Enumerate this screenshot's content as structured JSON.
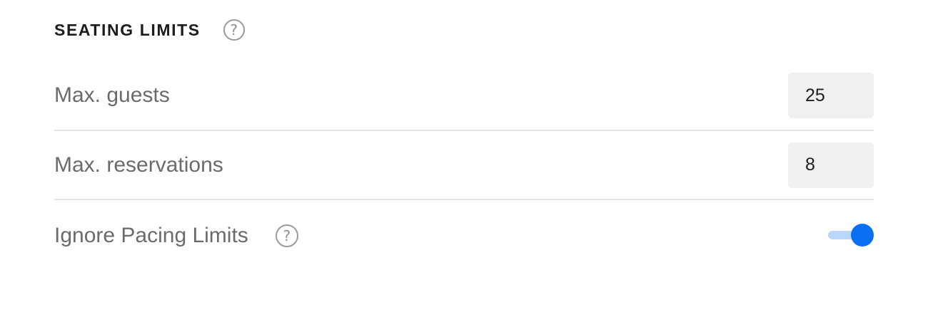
{
  "section": {
    "title": "SEATING LIMITS",
    "help_icon": "question-circle-icon"
  },
  "rows": [
    {
      "label": "Max. guests",
      "value": "25"
    },
    {
      "label": "Max. reservations",
      "value": "8"
    }
  ],
  "pacing": {
    "label": "Ignore Pacing Limits",
    "help_icon": "question-circle-icon",
    "toggle_on": true
  },
  "colors": {
    "accent": "#0a6ff3",
    "toggle_track": "#b9d8f9",
    "label_text": "#6b6b6b",
    "divider": "#e4e4e4",
    "value_bg": "#f0f0f0"
  }
}
